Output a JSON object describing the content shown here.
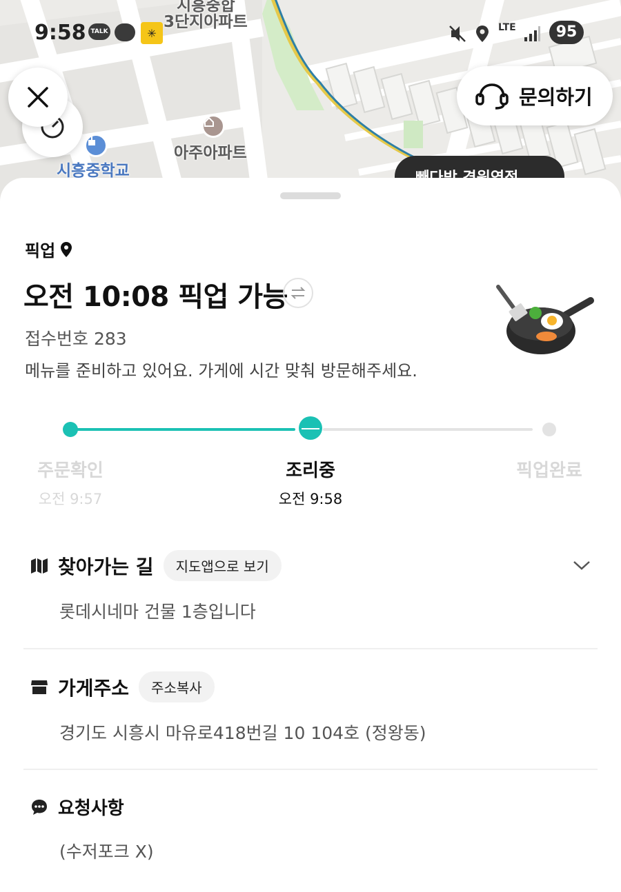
{
  "map": {
    "labels": [
      "3단지아파트",
      "아주아파트",
      "시흥중학교"
    ],
    "top_partial_label": "시흥중합",
    "chip_text": "빼다방 경원영점"
  },
  "status_bar": {
    "time": "9:58",
    "talk_label": "TALK",
    "network": "LTE",
    "battery": "95"
  },
  "header": {
    "inquiry_label": "문의하기"
  },
  "pickup": {
    "label": "픽업",
    "time_text": "오전 10:08 픽업 가능",
    "receipt": "접수번호 283",
    "message": "메뉴를 준비하고 있어요. 가게에 시간 맞춰 방문해주세요."
  },
  "progress": {
    "steps": [
      {
        "label": "주문확인",
        "time": "오전 9:57"
      },
      {
        "label": "조리중",
        "time": "오전 9:58"
      },
      {
        "label": "픽업완료",
        "time": ""
      }
    ],
    "current_step": 1
  },
  "directions": {
    "title": "찾아가는 길",
    "action": "지도앱으로 보기",
    "body": "롯데시네마 건물 1층입니다"
  },
  "address": {
    "title": "가게주소",
    "action": "주소복사",
    "body": "경기도 시흥시 마유로418번길 10 104호 (정왕동)"
  },
  "requests": {
    "title": "요청사항",
    "body": "(수저포크 X)"
  },
  "colors": {
    "accent": "#1bc1b4",
    "inactive": "#e3e3e3"
  }
}
